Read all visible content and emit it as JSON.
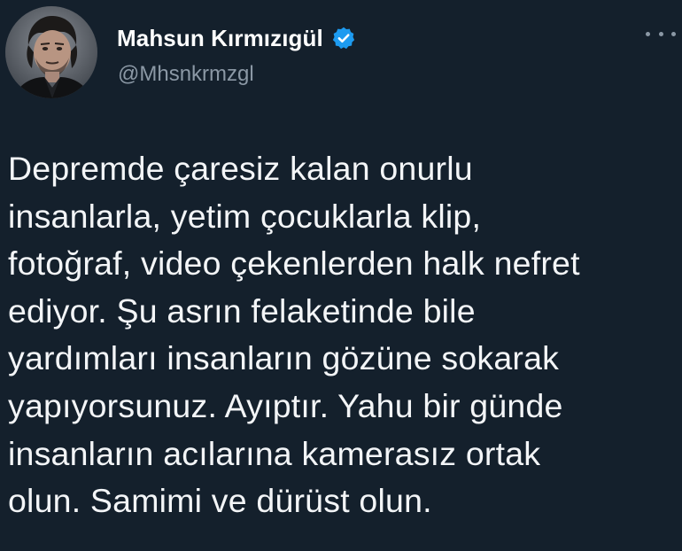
{
  "author": {
    "display_name": "Mahsun Kırmızıgül",
    "handle": "@Mhsnkrmzgl",
    "verified": true
  },
  "icons": {
    "avatar": "profile-photo",
    "verified": "verified-badge-icon",
    "more": "more-options-icon"
  },
  "tweet": {
    "lines": [
      "Depremde çaresiz kalan onurlu",
      "insanlarla, yetim çocuklarla klip,",
      "fotoğraf, video çekenlerden halk nefret",
      "ediyor. Şu asrın felaketinde bile",
      "yardımları insanların gözüne sokarak",
      "yapıyorsunuz. Ayıptır. Yahu bir günde",
      "insanların acılarına kamerasız ortak",
      "olun. Samimi ve dürüst olun."
    ]
  },
  "colors": {
    "background": "#15202b",
    "verified_blue": "#1d9bf0",
    "secondary_text": "#8b98a5"
  }
}
